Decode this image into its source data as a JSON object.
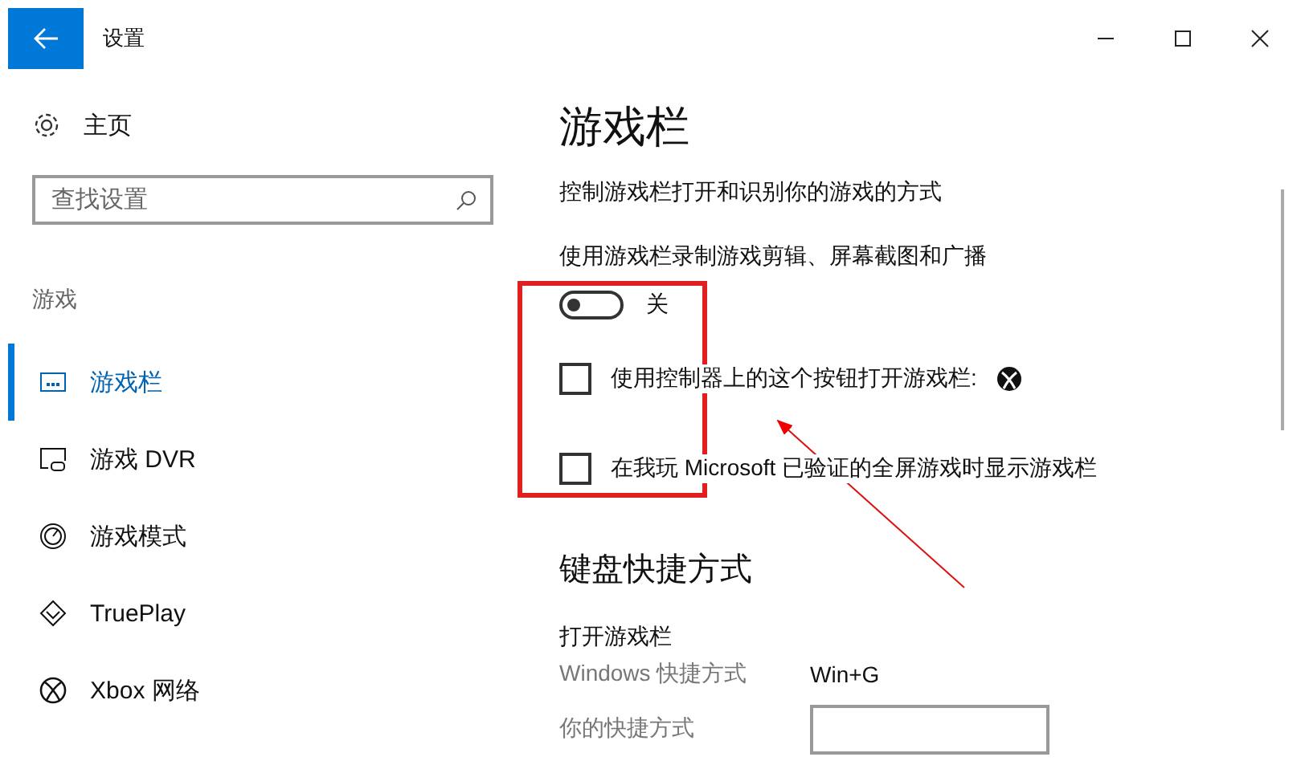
{
  "window": {
    "title": "设置"
  },
  "sidebar": {
    "home": "主页",
    "search": {
      "placeholder": "查找设置"
    },
    "section": "游戏",
    "items": [
      {
        "label": "游戏栏",
        "selected": true
      },
      {
        "label": "游戏 DVR",
        "selected": false
      },
      {
        "label": "游戏模式",
        "selected": false
      },
      {
        "label": "TruePlay",
        "selected": false
      },
      {
        "label": "Xbox 网络",
        "selected": false
      }
    ]
  },
  "content": {
    "title": "游戏栏",
    "description": "控制游戏栏打开和识别你的游戏的方式",
    "record": {
      "label": "使用游戏栏录制游戏剪辑、屏幕截图和广播",
      "on": false,
      "state": "关"
    },
    "options": [
      {
        "kind": "icon",
        "label": "使用控制器上的这个按钮打开游戏栏:",
        "checked": false
      },
      {
        "kind": "plain",
        "label": "在我玩 Microsoft 已验证的全屏游戏时显示游戏栏",
        "checked": false
      }
    ],
    "shortcuts": {
      "title": "键盘快捷方式",
      "group": "打开游戏栏",
      "rows": [
        {
          "label": "Windows 快捷方式",
          "kind": "text",
          "value": "Win+G"
        },
        {
          "label": "你的快捷方式",
          "kind": "field"
        }
      ]
    }
  }
}
